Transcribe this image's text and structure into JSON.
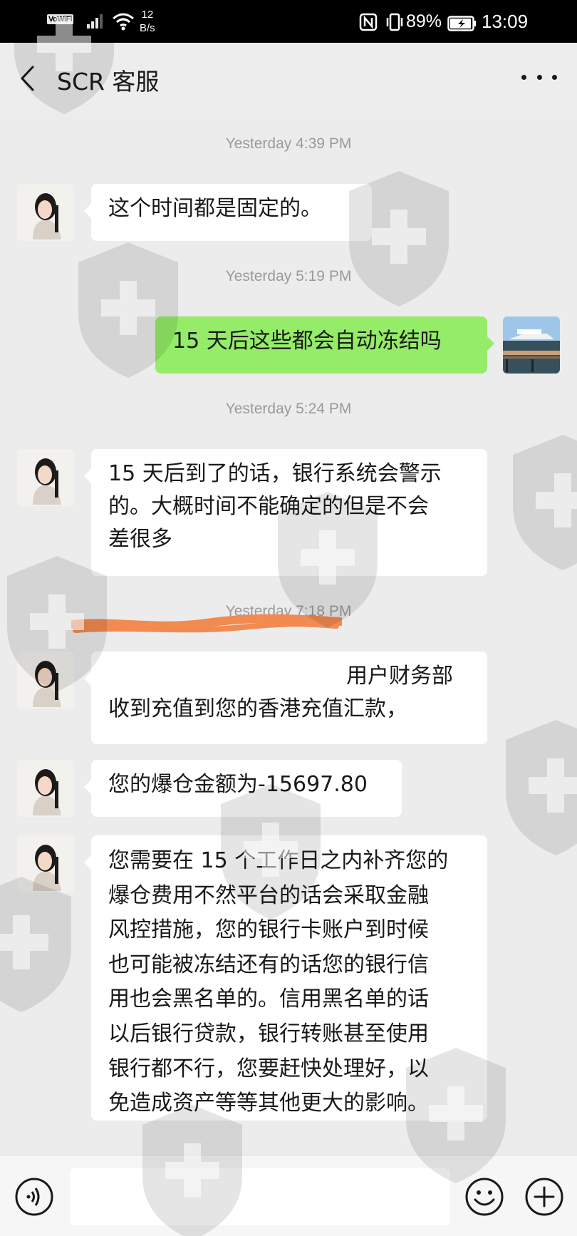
{
  "status_bar": {
    "vowifi": "VoWiFi",
    "speed_value": "12",
    "speed_unit": "B/s",
    "battery_percent": "89%",
    "time": "13:09"
  },
  "header": {
    "title": "SCR 客服",
    "back_icon": "chevron-left-icon",
    "more_icon": "more-dots-icon"
  },
  "messages": [
    {
      "timestamp": "Yesterday 4:39 PM"
    },
    {
      "from": "contact",
      "text": "这个时间都是固定的。"
    },
    {
      "timestamp": "Yesterday 5:19 PM"
    },
    {
      "from": "me",
      "text": "15 天后这些都会自动冻结吗"
    },
    {
      "timestamp": "Yesterday 5:24 PM"
    },
    {
      "from": "contact",
      "lines": [
        "15 天后到了的话，银行系统会警示",
        "的。大概时间不能确定的但是不会",
        "差很多"
      ]
    },
    {
      "timestamp": "Yesterday 7:18 PM"
    },
    {
      "from": "contact",
      "lines": [
        "用户财务部",
        "收到充值到您的香港充值汇款，"
      ]
    },
    {
      "from": "contact",
      "text": "您的爆仓金额为-15697.80"
    },
    {
      "from": "contact",
      "lines": [
        "您需要在 15 个工作日之内补齐您的",
        "爆仓费用不然平台的话会采取金融",
        "风控措施，您的银行卡账户到时候",
        "也可能被冻结还有的话您的银行信",
        "用也会黑名单的。信用黑名单的话",
        "以后银行贷款，银行转账甚至使用",
        "银行都不行，您要赶快处理好，以",
        "免造成资产等等其他更大的影响。"
      ]
    }
  ],
  "input_bar": {
    "voice_icon": "voice-icon",
    "emoji_icon": "emoji-icon",
    "plus_icon": "plus-icon"
  },
  "colors": {
    "background": "#ededed",
    "outgoing_bubble": "#95ec69",
    "incoming_bubble": "#ffffff",
    "redaction": "#f28b52"
  }
}
